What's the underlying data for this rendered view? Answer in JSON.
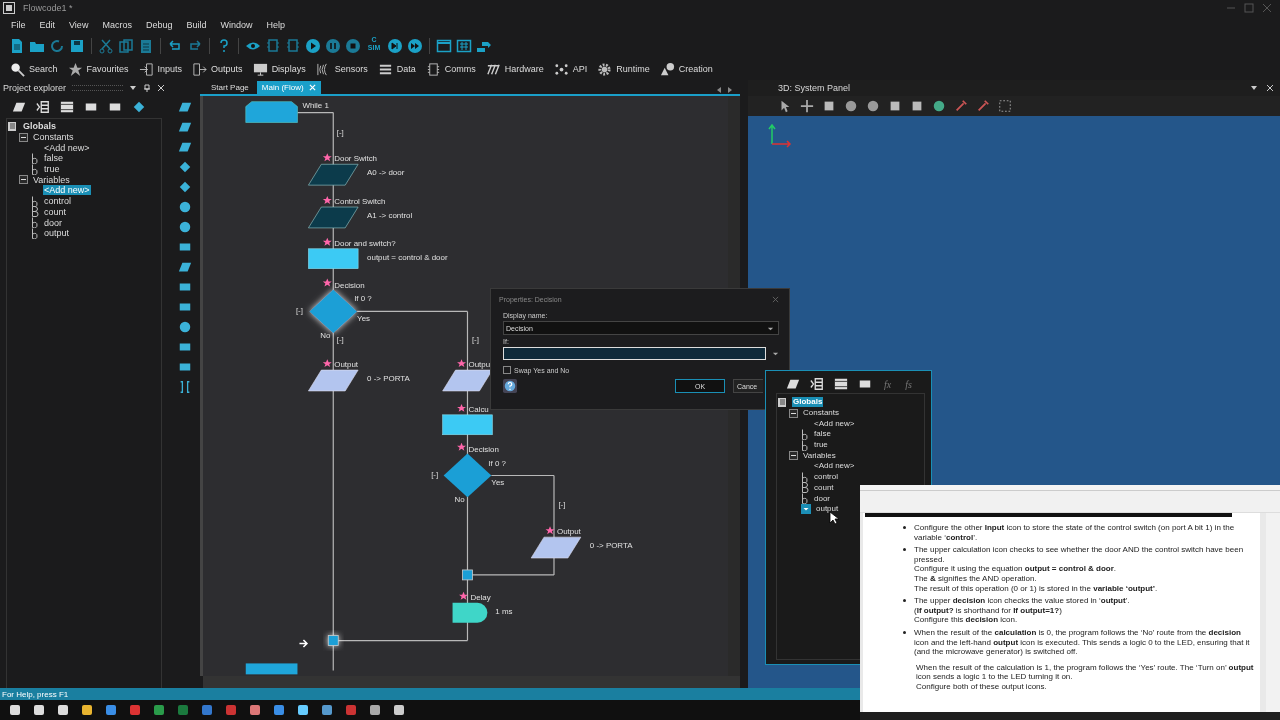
{
  "window": {
    "title": "Flowcode1 *"
  },
  "menu": [
    "File",
    "Edit",
    "View",
    "Macros",
    "Debug",
    "Build",
    "Window",
    "Help"
  ],
  "toolbar": {
    "sim_button": {
      "top": "C",
      "bottom": "SIM"
    }
  },
  "categories": [
    "Search",
    "Favourites",
    "Inputs",
    "Outputs",
    "Displays",
    "Sensors",
    "Data",
    "Comms",
    "Hardware",
    "API",
    "Runtime",
    "Creation"
  ],
  "project_explorer": {
    "title": "Project explorer",
    "tree": [
      {
        "label": "Globals",
        "kind": "root",
        "selected": false,
        "children": [
          {
            "label": "Constants",
            "kind": "folder",
            "expanded": true,
            "selected": false,
            "children": [
              {
                "label": "<Add new>",
                "kind": "add",
                "selected": false
              },
              {
                "label": "false",
                "kind": "bool",
                "selected": false
              },
              {
                "label": "true",
                "kind": "bool",
                "selected": false
              }
            ]
          },
          {
            "label": "Variables",
            "kind": "folder",
            "expanded": true,
            "selected": false,
            "children": [
              {
                "label": "<Add new>",
                "kind": "add",
                "selected": true
              },
              {
                "label": "control",
                "kind": "bool",
                "selected": false
              },
              {
                "label": "count",
                "kind": "byte",
                "selected": false
              },
              {
                "label": "door",
                "kind": "bool",
                "selected": false
              },
              {
                "label": "output",
                "kind": "bool",
                "selected": false
              }
            ]
          }
        ]
      }
    ]
  },
  "editor": {
    "tabs": [
      {
        "label": "Start Page",
        "selected": false
      },
      {
        "label": "Main (Flow)",
        "selected": true
      }
    ],
    "flowchart": {
      "nodes": [
        {
          "kind": "loop",
          "text": "While 1",
          "selected": false
        },
        {
          "kind": "input",
          "title": "Door Switch",
          "text": "A0 -> door",
          "selected": false
        },
        {
          "kind": "input",
          "title": "Control Switch",
          "text": "A1 -> control",
          "selected": false
        },
        {
          "kind": "calc",
          "title": "Door and switch?",
          "text": "output = control & door",
          "selected": false
        },
        {
          "kind": "decision",
          "title": "Decision",
          "text": "If 0 ?",
          "yes": "Yes",
          "no": "No",
          "selected": true
        },
        {
          "kind": "output",
          "title": "Output",
          "text": "0 -> PORTA",
          "selected": false
        },
        {
          "kind": "output",
          "title": "Outpu",
          "selected": false
        },
        {
          "kind": "calc",
          "title": "Calcu",
          "selected": false
        },
        {
          "kind": "decision",
          "title": "Decision",
          "text": "If 0 ?",
          "yes": "Yes",
          "no": "No",
          "selected": false
        },
        {
          "kind": "output",
          "title": "Output",
          "text": "0 -> PORTA",
          "selected": false
        },
        {
          "kind": "junction",
          "selected": false
        },
        {
          "kind": "delay",
          "title": "Delay",
          "text": "1 ms",
          "selected": false
        },
        {
          "kind": "junction",
          "selected": true
        },
        {
          "kind": "loop_end",
          "selected": false
        }
      ],
      "collapse_markers": [
        "[-]",
        "[-]",
        "[-]",
        "[-]",
        "[-]",
        "[-]"
      ]
    }
  },
  "properties_dialog": {
    "title": "Properties: Decision",
    "display_name_label": "Display name:",
    "display_name": "Decision",
    "if_label": "If:",
    "swap_label": "Swap Yes and No",
    "swap_checked": false,
    "ok": "OK",
    "cancel": "Cance"
  },
  "globals_popup": {
    "function_buttons": [
      "fx",
      "fs"
    ],
    "tree": [
      {
        "label": "Globals",
        "kind": "root",
        "selected": true,
        "children": [
          {
            "label": "Constants",
            "kind": "folder",
            "expanded": true,
            "selected": false,
            "children": [
              {
                "label": "<Add new>",
                "kind": "add",
                "selected": false
              },
              {
                "label": "false",
                "kind": "bool",
                "selected": false
              },
              {
                "label": "true",
                "kind": "bool",
                "selected": false
              }
            ]
          },
          {
            "label": "Variables",
            "kind": "folder",
            "expanded": true,
            "selected": false,
            "children": [
              {
                "label": "<Add new>",
                "kind": "add",
                "selected": false
              },
              {
                "label": "control",
                "kind": "bool",
                "selected": false
              },
              {
                "label": "count",
                "kind": "byte",
                "selected": false
              },
              {
                "label": "door",
                "kind": "bool",
                "selected": false
              },
              {
                "label": "output",
                "kind": "dropdown",
                "selected": false
              }
            ]
          }
        ]
      }
    ]
  },
  "system_panel": {
    "title": "3D: System Panel"
  },
  "document": {
    "blocks": [
      {
        "kind": "bullet",
        "lines": [
          "Configure the other **Input** icon to store the state of the control switch (on port A bit 1) in the variable ‘**control**’."
        ]
      },
      {
        "kind": "bullet",
        "lines": [
          "The upper calculation icon checks to see whether the door AND the control switch have been pressed.",
          "Configure it using the equation **output = control & door**.",
          "The **&** signifies the AND operation.",
          "The result of this operation (0 or 1) is stored in the **variable ‘output’**."
        ]
      },
      {
        "kind": "bullet",
        "lines": [
          "The upper **decision** icon checks the value stored in ‘**output**’.",
          "(**If output?** is shorthand for **If output=1?**)",
          "Configure this **decision** icon."
        ]
      },
      {
        "kind": "bullet",
        "lines": [
          "When the result of the **calculation** is 0, the program follows the ‘No’ route from the **decision** icon and the left-hand **output** icon is executed. This sends a logic 0 to the LED, ensuring that it (and the microwave generator) is switched off."
        ]
      },
      {
        "kind": "plain",
        "lines": [
          "When the result of the calculation is 1, the program follows the ‘Yes’ route. The ‘Turn on’ **output** icon sends a logic 1 to the LED turning it on.",
          "Configure both of these output icons."
        ]
      }
    ]
  },
  "status_bar": "For Help, press F1"
}
